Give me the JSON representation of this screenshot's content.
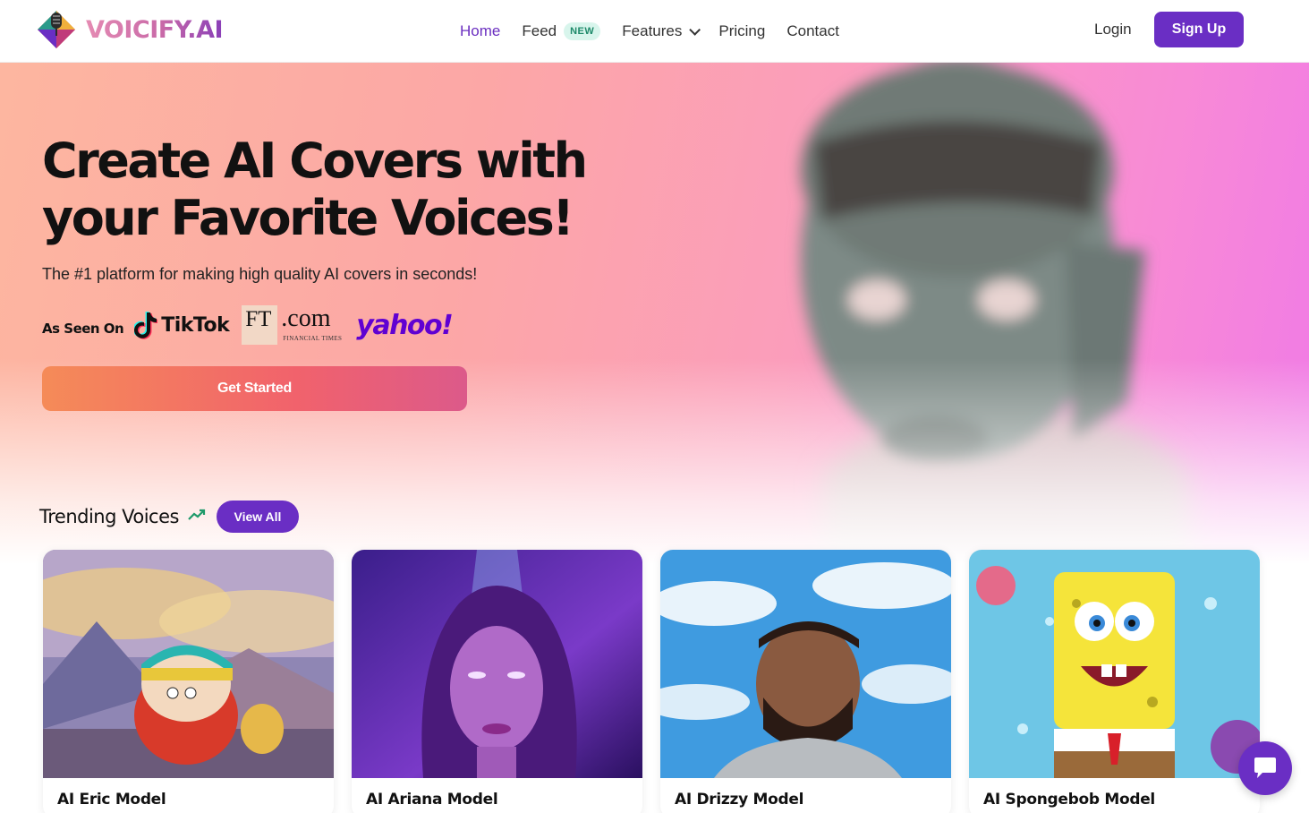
{
  "brand": {
    "name": "VOICIFY.AI",
    "logo_icon": "microphone-gem-icon"
  },
  "nav": {
    "items": [
      {
        "label": "Home",
        "active": true
      },
      {
        "label": "Feed",
        "badge": "NEW"
      },
      {
        "label": "Features",
        "has_dropdown": true
      },
      {
        "label": "Pricing"
      },
      {
        "label": "Contact"
      }
    ],
    "login": "Login",
    "signup": "Sign Up"
  },
  "hero": {
    "title_line1": "Create AI Covers with",
    "title_line2": "your Favorite Voices!",
    "subtitle": "The #1 platform for making high quality AI covers in seconds!",
    "seen_on_label": "As Seen On",
    "press": {
      "tiktok": "TikTok",
      "ft_box": "FT",
      "ft_com": ".com",
      "ft_small": "FINANCIAL TIMES",
      "yahoo": "yahoo!"
    },
    "cta": "Get Started"
  },
  "trending": {
    "title": "Trending Voices",
    "view_all": "View All",
    "cards": [
      {
        "name": "AI Eric Model"
      },
      {
        "name": "AI Ariana Model"
      },
      {
        "name": "AI Drizzy Model"
      },
      {
        "name": "AI Spongebob Model"
      }
    ]
  },
  "colors": {
    "accent": "#6a2ec4",
    "new_badge_bg": "#d8f5ec",
    "new_badge_text": "#1e8a6a",
    "cta_start": "#f58b58",
    "cta_end": "#dc5a8a",
    "yahoo": "#6001d2"
  },
  "chat": {
    "icon": "chat-bubble-icon"
  }
}
